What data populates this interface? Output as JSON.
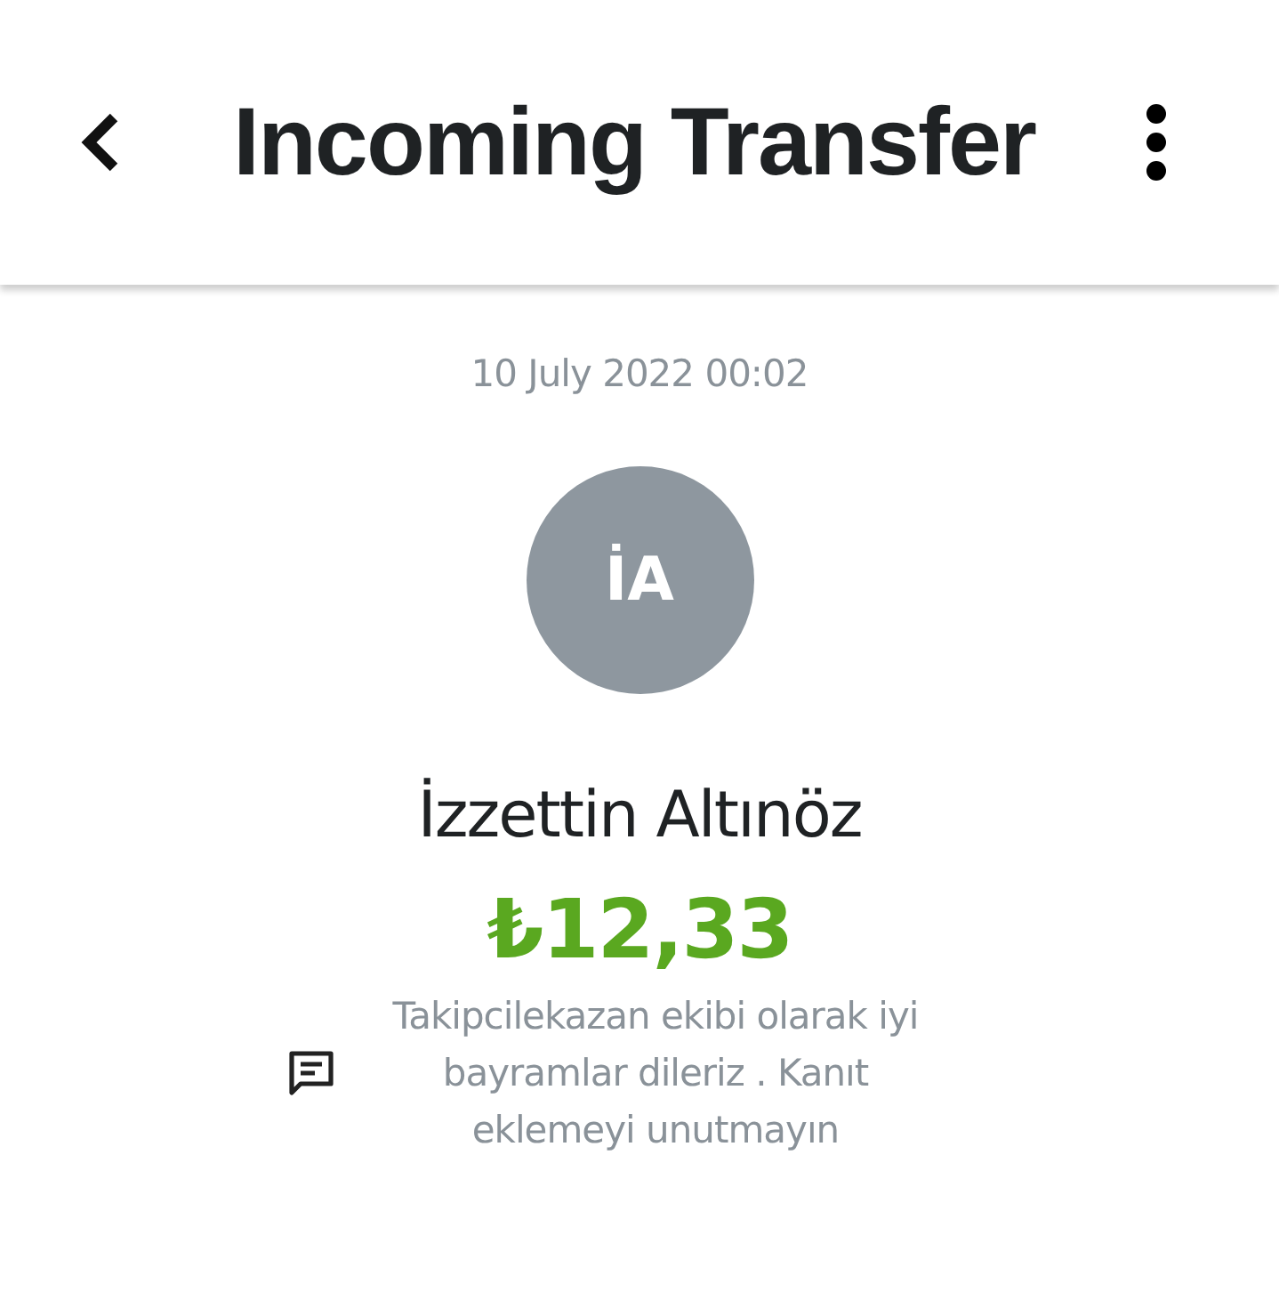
{
  "header": {
    "title": "Incoming Transfer"
  },
  "date": "10 July 2022 00:02",
  "sender": {
    "initials": "İA",
    "name": "İzzettin Altınöz"
  },
  "amount": "₺12,33",
  "message": "Takipcilekazan ekibi olarak iyi bayramlar dileriz . Kanıt eklemeyi unutmayın"
}
